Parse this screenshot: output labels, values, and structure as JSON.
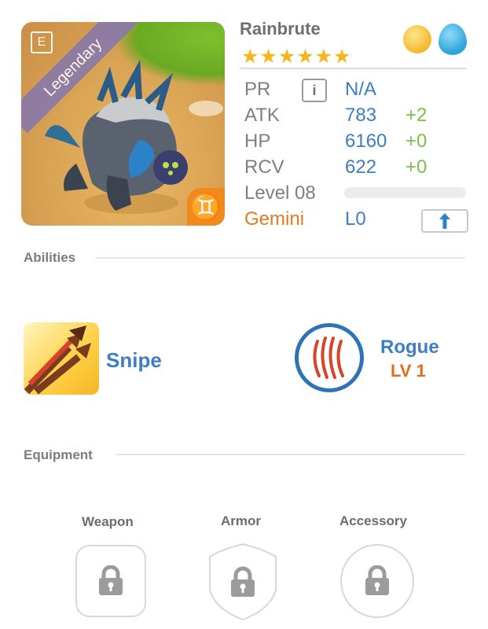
{
  "monster": {
    "name": "Rainbrute",
    "rarity": "Legendary",
    "stars": "★★★★★★",
    "zodiac_glyph": "♊",
    "elements": [
      "light",
      "water"
    ]
  },
  "stats": {
    "pr": {
      "label": "PR",
      "value": "N/A",
      "info_icon": "i"
    },
    "atk": {
      "label": "ATK",
      "value": "783",
      "bonus": "+2"
    },
    "hp": {
      "label": "HP",
      "value": "6160",
      "bonus": "+0"
    },
    "rcv": {
      "label": "RCV",
      "value": "622",
      "bonus": "+0"
    },
    "level": {
      "label": "Level 08",
      "progress": 0
    },
    "sign": {
      "label": "Gemini",
      "value": "L0"
    }
  },
  "abilities": {
    "title": "Abilities",
    "items": [
      {
        "name": "Snipe"
      },
      {
        "name": "Rogue",
        "level": "LV 1"
      }
    ]
  },
  "equipment": {
    "title": "Equipment",
    "slots": [
      {
        "label": "Weapon",
        "locked": true
      },
      {
        "label": "Armor",
        "locked": true
      },
      {
        "label": "Accessory",
        "locked": true
      }
    ]
  },
  "colors": {
    "accent_blue": "#3d7dc2",
    "bonus_green": "#7ac04a",
    "gemini_orange": "#e07b22",
    "star_gold": "#f6b619"
  }
}
